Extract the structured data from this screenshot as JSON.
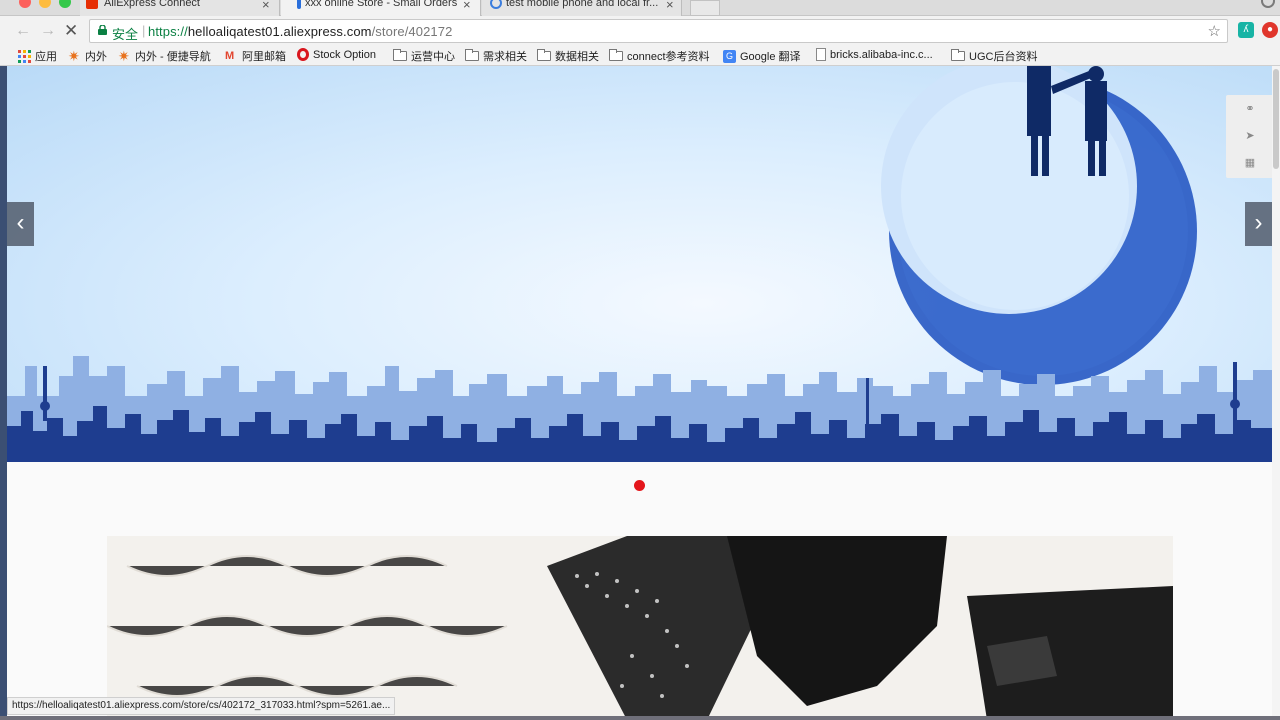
{
  "tabs": [
    {
      "title": "AliExpress Connect",
      "favicon_color": "#e62e04"
    },
    {
      "title": "xxx online Store - Small Orders",
      "favicon_color": "#2a6fdb"
    },
    {
      "title": "test mobile phone and local fr...",
      "favicon_color": "#3b7ddd"
    }
  ],
  "address_bar": {
    "secure_label": "安全",
    "url_scheme": "https://",
    "url_host": "helloaliqatest01.aliexpress.com",
    "url_path": "/store/402172"
  },
  "bookmarks": [
    {
      "label": "应用",
      "icon": "apps-grid-icon"
    },
    {
      "label": "内外",
      "icon": "star-logo-icon"
    },
    {
      "label": "内外 - 便捷导航",
      "icon": "star-logo-icon"
    },
    {
      "label": "阿里邮箱",
      "icon": "mail-logo-icon"
    },
    {
      "label": "Stock Option",
      "icon": "opera-icon"
    },
    {
      "label": "运营中心",
      "icon": "folder-icon"
    },
    {
      "label": "需求相关",
      "icon": "folder-icon"
    },
    {
      "label": "数据相关",
      "icon": "folder-icon"
    },
    {
      "label": "connect参考资料",
      "icon": "folder-icon"
    },
    {
      "label": "Google 翻译",
      "icon": "google-translate-icon"
    },
    {
      "label": "bricks.alibaba-inc.c...",
      "icon": "page-icon"
    },
    {
      "label": "UGC后台资料",
      "icon": "folder-icon"
    }
  ],
  "banner": {
    "active_slide_dot_color": "#e4161b",
    "prev_icon": "chevron-left-icon",
    "next_icon": "chevron-right-icon"
  },
  "side_tools": [
    "share-icon",
    "location-arrow-icon",
    "calendar-icon"
  ],
  "status_url": "https://helloaliqatest01.aliexpress.com/store/cs/402172_317033.html?spm=5261.ae...",
  "colors": {
    "secure_green": "#0b8043",
    "skyline_dark": "#1e3d8f",
    "skyline_light": "#7fa2dc",
    "moon_blue": "#2a5bc4"
  }
}
